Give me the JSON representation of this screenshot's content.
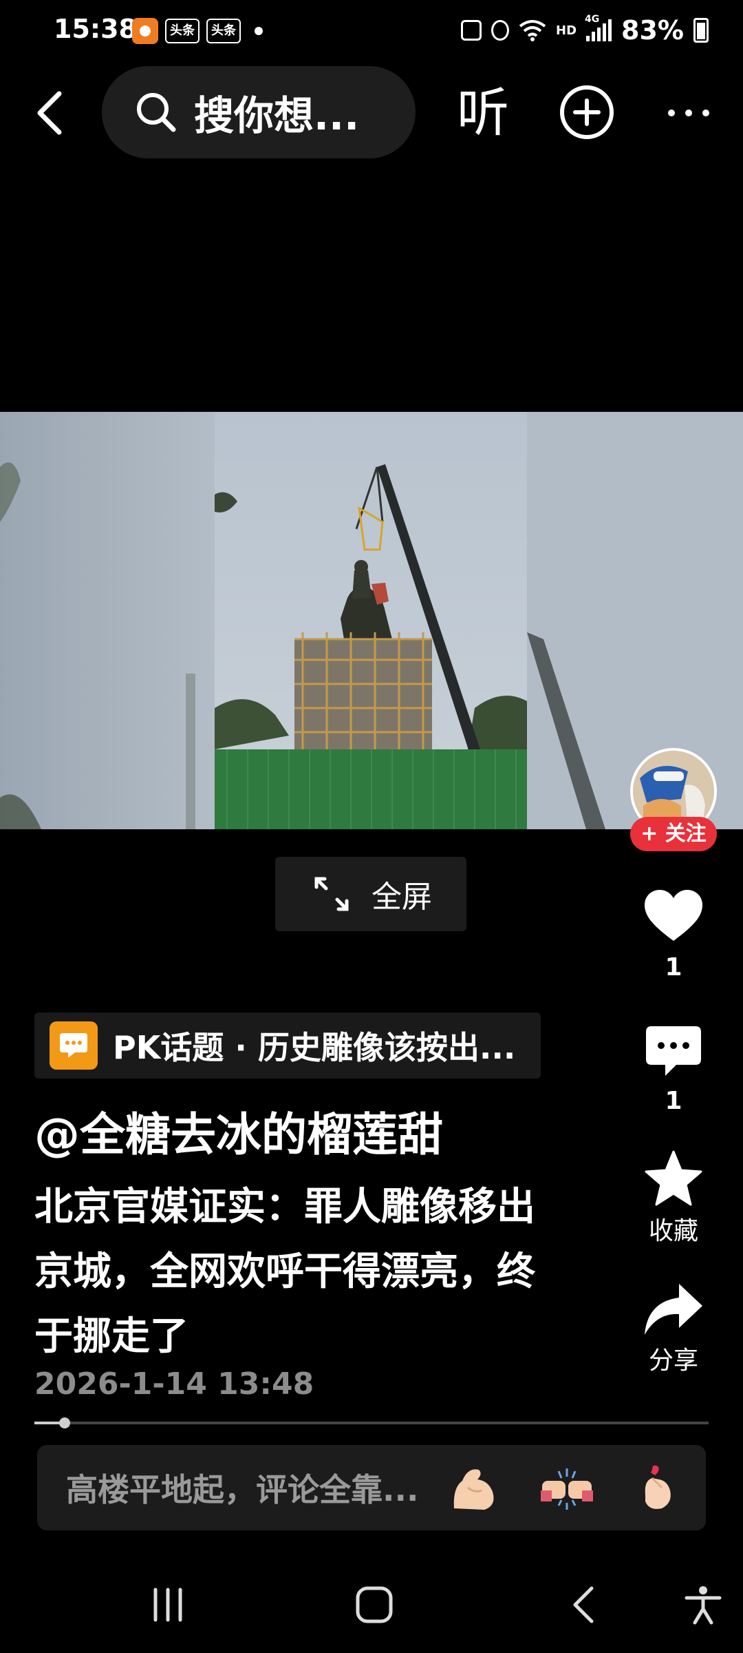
{
  "status_bar": {
    "time": "15:38",
    "app_badges": [
      "头条",
      "头条"
    ],
    "network": "HD",
    "network_gen": "4G",
    "battery": "83%"
  },
  "top_nav": {
    "search_text": "搜你想...",
    "listen_label": "听"
  },
  "video": {
    "fullscreen_label": "全屏"
  },
  "side_rail": {
    "follow_label": "+ 关注",
    "like_count": "1",
    "comment_count": "1",
    "favorite_label": "收藏",
    "share_label": "分享"
  },
  "post": {
    "pk_topic": "PK话题 · 历史雕像该按出...",
    "author": "@全糖去冰的榴莲甜",
    "title": "北京官媒证实：罪人雕像移出京城，全网欢呼干得漂亮，终于挪走了",
    "timestamp": "2026-1-14 13:48",
    "progress": 0.045
  },
  "comment_bar": {
    "placeholder": "高楼平地起，评论全靠..."
  },
  "icons": {
    "back": "back-arrow-icon",
    "search": "search-icon",
    "add": "plus-circle-icon",
    "more": "more-dots-icon",
    "like": "heart-icon",
    "comment": "comment-bubble-icon",
    "favorite": "star-icon",
    "share": "share-arrow-icon",
    "emojis": [
      "flexed-biceps-emoji",
      "fist-bump-emoji",
      "finger-heart-emoji"
    ]
  },
  "colors": {
    "background": "#000000",
    "follow_red": "#e8313a",
    "topic_orange": "#f29a16",
    "muted_text": "#8c8c8c"
  }
}
